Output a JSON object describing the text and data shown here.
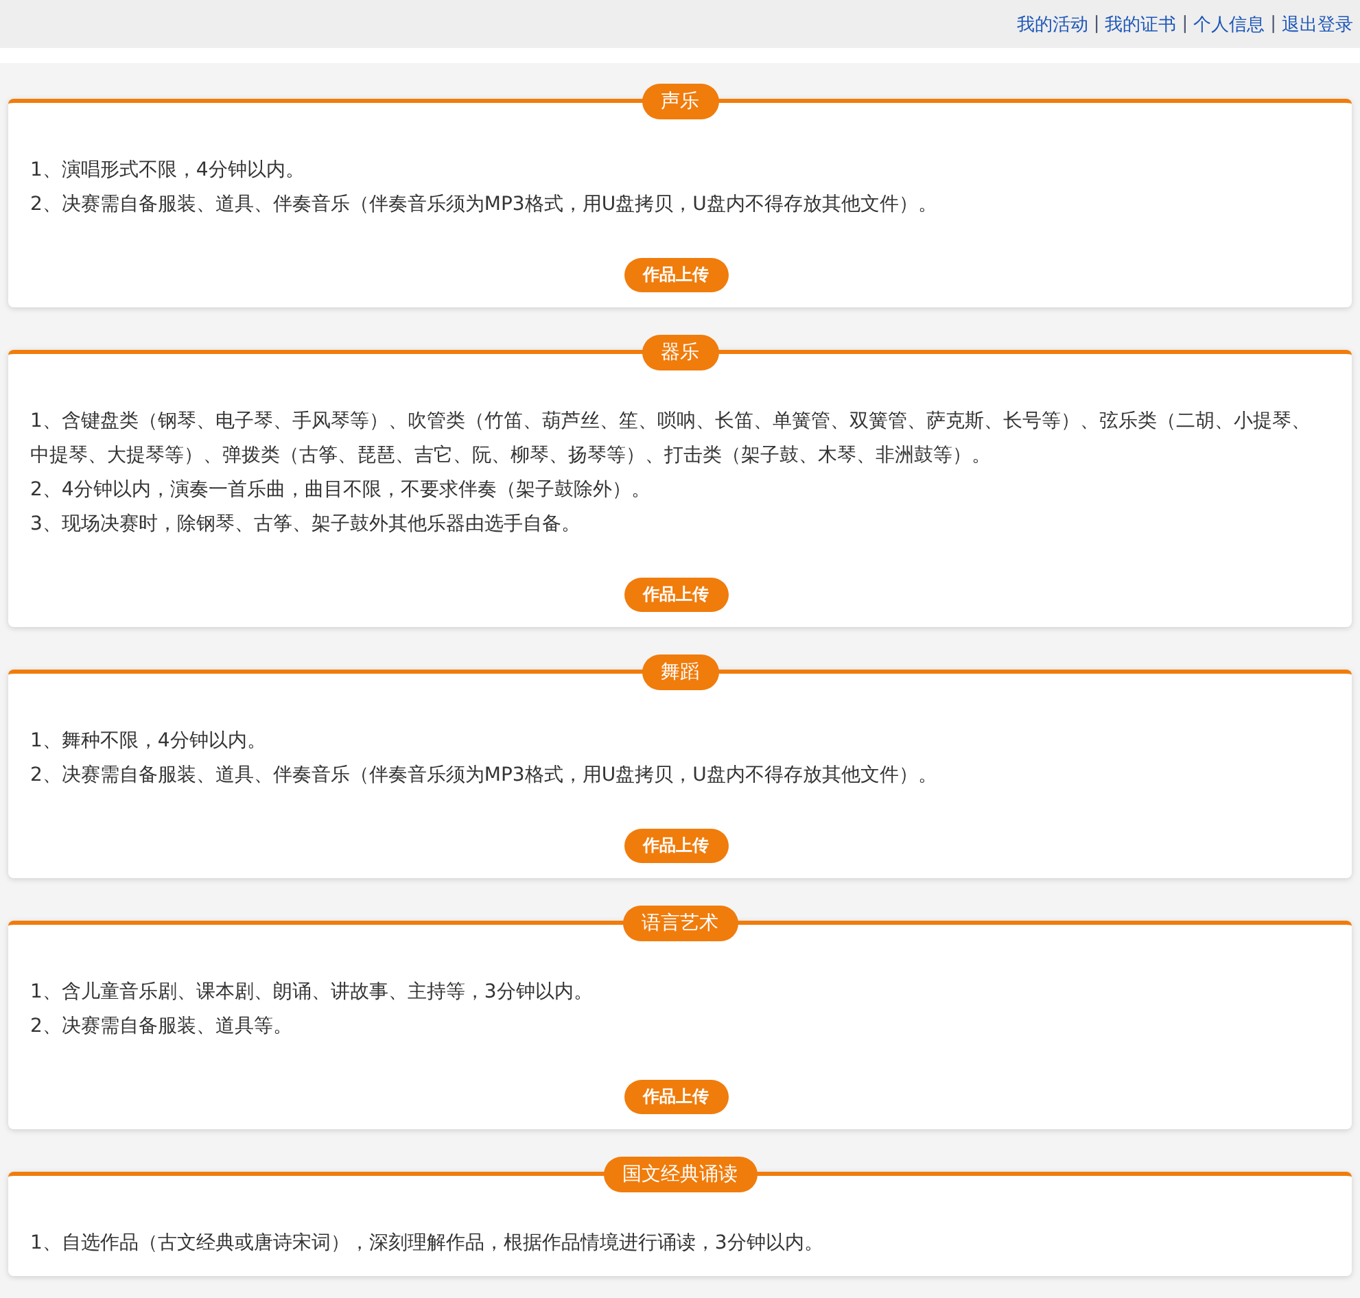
{
  "top_nav": [
    {
      "kind": "link",
      "text": "我的活动"
    },
    {
      "kind": "separator",
      "text": "|"
    },
    {
      "kind": "link",
      "text": "我的证书"
    },
    {
      "kind": "separator",
      "text": "|"
    },
    {
      "kind": "link",
      "text": "个人信息"
    },
    {
      "kind": "separator",
      "text": "|"
    },
    {
      "kind": "link",
      "text": "退出登录"
    }
  ],
  "sections": [
    {
      "title": "声乐",
      "rules": [
        "1、演唱形式不限，4分钟以内。",
        "2、决赛需自备服装、道具、伴奏音乐（伴奏音乐须为MP3格式，用U盘拷贝，U盘内不得存放其他文件）。"
      ],
      "button": "作品上传"
    },
    {
      "title": "器乐",
      "rules": [
        "1、含键盘类（钢琴、电子琴、手风琴等）、吹管类（竹笛、葫芦丝、笙、唢呐、长笛、单簧管、双簧管、萨克斯、长号等）、弦乐类（二胡、小提琴、中提琴、大提琴等）、弹拨类（古筝、琵琶、吉它、阮、柳琴、扬琴等）、打击类（架子鼓、木琴、非洲鼓等）。",
        "2、4分钟以内，演奏一首乐曲，曲目不限，不要求伴奏（架子鼓除外）。",
        "3、现场决赛时，除钢琴、古筝、架子鼓外其他乐器由选手自备。"
      ],
      "button": "作品上传"
    },
    {
      "title": "舞蹈",
      "rules": [
        "1、舞种不限，4分钟以内。",
        "2、决赛需自备服装、道具、伴奏音乐（伴奏音乐须为MP3格式，用U盘拷贝，U盘内不得存放其他文件）。"
      ],
      "button": "作品上传"
    },
    {
      "title": "语言艺术",
      "rules": [
        "1、含儿童音乐剧、课本剧、朗诵、讲故事、主持等，3分钟以内。",
        "2、决赛需自备服装、道具等。"
      ],
      "button": "作品上传"
    },
    {
      "title": "国文经典诵读",
      "rules": [
        "1、自选作品（古文经典或唐诗宋词），深刻理解作品，根据作品情境进行诵读，3分钟以内。"
      ]
    }
  ]
}
